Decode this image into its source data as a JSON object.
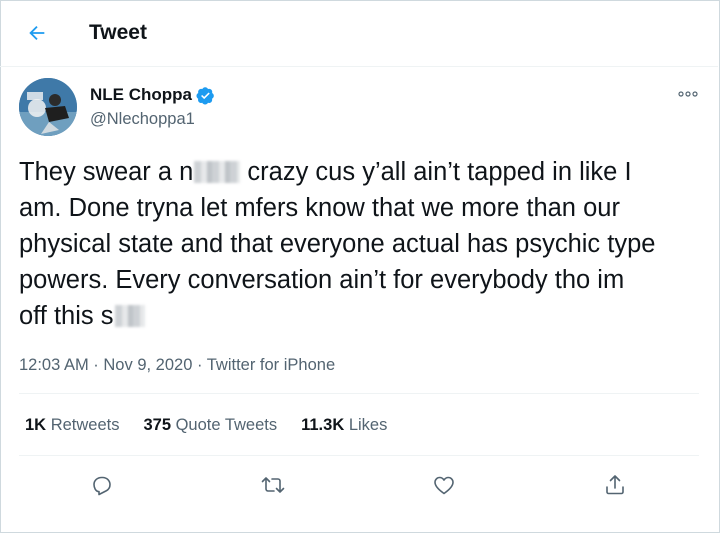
{
  "header": {
    "title": "Tweet",
    "back_icon": "arrow-left-icon"
  },
  "author": {
    "name": "NLE Choppa",
    "handle": "@Nlechoppa1",
    "verified": true,
    "avatar_icon": "profile-photo"
  },
  "tweet": {
    "lines": [
      {
        "before": "They swear a n",
        "censored": true,
        "after": " crazy cus y’all ain’t tapped in like I"
      },
      {
        "before": "am. Done tryna let mfers know that we more than our",
        "censored": false,
        "after": ""
      },
      {
        "before": "physical state and that everyone actual has psychic type",
        "censored": false,
        "after": ""
      },
      {
        "before": "powers. Every conversation ain’t for everybody tho im",
        "censored": false,
        "after": ""
      },
      {
        "before": "off this s",
        "censored": true,
        "after": ""
      }
    ],
    "time": "12:03 AM",
    "separator": " · ",
    "date": "Nov 9, 2020",
    "source": "Twitter for iPhone"
  },
  "stats": {
    "retweets_count": "1K",
    "retweets_label": "Retweets",
    "quotes_count": "375",
    "quotes_label": "Quote Tweets",
    "likes_count": "11.3K",
    "likes_label": "Likes"
  },
  "actions": [
    "reply-icon",
    "retweet-icon",
    "like-icon",
    "share-icon"
  ],
  "colors": {
    "accent": "#1d9bf0",
    "text": "#0f1419",
    "muted": "#536471",
    "border": "#eff3f4"
  }
}
